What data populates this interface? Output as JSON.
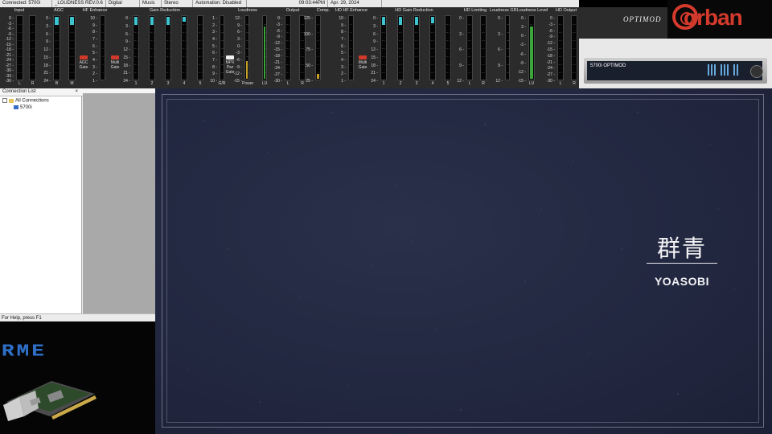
{
  "status_bar": {
    "connected": "Connected: 5700i",
    "preset": "_LOUDNESS REV.0.6",
    "input": "Digital",
    "mode": "Music",
    "stereo": "Stereo",
    "automation": "Automation: Disabled",
    "time": "09:03:44PM",
    "date": "Apr. 29, 2024"
  },
  "meters": {
    "brand_label": "OPTIMOD",
    "sections": [
      {
        "id": "input",
        "title": "Input",
        "ticks": [
          "0",
          "-3",
          "-6",
          "-9",
          "-12",
          "-15",
          "-18",
          "-21",
          "-24",
          "-27",
          "-30",
          "-33",
          "-36"
        ],
        "channels": [
          "L",
          "R"
        ],
        "levels": [
          0,
          0
        ]
      },
      {
        "id": "agc",
        "title": "AGC",
        "ticks": [
          "0",
          "3",
          "6",
          "9",
          "12",
          "15",
          "18",
          "21",
          "24"
        ],
        "channels": [
          "B",
          "M"
        ],
        "levels": [
          0.13,
          0.13
        ]
      },
      {
        "id": "hf_enhance",
        "title": "HF Enhance",
        "ticks": [
          "10",
          "9",
          "8",
          "7",
          "6",
          "5",
          "4",
          "3",
          "2",
          "1"
        ],
        "channels": [
          ""
        ],
        "levels": [
          0
        ]
      },
      {
        "id": "gain_reduction",
        "title": "Gain Reduction",
        "ticks": [
          "0",
          "3",
          "6",
          "9",
          "12",
          "15",
          "18",
          "21",
          "24"
        ],
        "channels": [
          "1",
          "2",
          "3",
          "4",
          "5"
        ],
        "levels": [
          0.13,
          0.13,
          0.13,
          0.08,
          0
        ]
      },
      {
        "id": "gr",
        "title": "",
        "ticks": [
          "1",
          "2",
          "3",
          "4",
          "5",
          "6",
          "7",
          "8",
          "9",
          "10"
        ],
        "channels": [
          "G/R"
        ],
        "levels": [
          0
        ]
      },
      {
        "id": "loudness",
        "title": "Loudness",
        "ticks": [
          "12",
          "9",
          "6",
          "3",
          "0",
          "-3",
          "-6",
          "-9",
          "-12",
          "-15"
        ],
        "channels": [
          "Power",
          "LU"
        ],
        "levels": [
          0.28,
          0.82
        ]
      },
      {
        "id": "output",
        "title": "Output",
        "ticks": [
          "0",
          "-3",
          "-6",
          "-9",
          "-12",
          "-15",
          "-18",
          "-21",
          "-24",
          "-27",
          "-30"
        ],
        "channels": [
          "L",
          "R"
        ],
        "levels": [
          0,
          0
        ]
      },
      {
        "id": "comp",
        "title": "Comp.",
        "ticks": [
          "125",
          "100",
          "75",
          "50",
          "25"
        ],
        "channels": [
          ""
        ],
        "levels": [
          0.08
        ]
      },
      {
        "id": "hd_hf_enhance",
        "title": "HD HF Enhance",
        "ticks": [
          "10",
          "9",
          "8",
          "7",
          "6",
          "5",
          "4",
          "3",
          "2",
          "1"
        ],
        "channels": [
          ""
        ],
        "levels": [
          0
        ]
      },
      {
        "id": "hd_gain_reduction",
        "title": "HD Gain Reduction",
        "ticks": [
          "0",
          "3",
          "6",
          "9",
          "12",
          "15",
          "18",
          "21",
          "24"
        ],
        "channels": [
          "1",
          "2",
          "3",
          "4",
          "5"
        ],
        "levels": [
          0.13,
          0.13,
          0.13,
          0.1,
          0
        ]
      },
      {
        "id": "hd_limiting",
        "title": "HD Limiting",
        "ticks": [
          "0",
          "3",
          "6",
          "9",
          "12"
        ],
        "channels": [
          "L",
          "R"
        ],
        "levels": [
          0,
          0
        ]
      },
      {
        "id": "loudness_gr",
        "title": "Loudness GR",
        "ticks": [
          "0",
          "3",
          "6",
          "9",
          "12"
        ],
        "channels": [
          ""
        ],
        "levels": [
          0
        ]
      },
      {
        "id": "loudness_level",
        "title": "Loudness Level",
        "ticks": [
          "6",
          "3",
          "0",
          "-3",
          "-6",
          "-9",
          "-12",
          "-15"
        ],
        "channels": [
          "LU"
        ],
        "levels": [
          0.82
        ]
      },
      {
        "id": "hd_output",
        "title": "HD Output",
        "ticks": [
          "0",
          "-3",
          "-6",
          "-9",
          "-12",
          "-15",
          "-18",
          "-21",
          "-24",
          "-27",
          "-30"
        ],
        "channels": [
          "L",
          "R"
        ],
        "levels": [
          0,
          0
        ]
      }
    ],
    "gates": {
      "agc_gate": "AGC Gate",
      "multi_gate": "Multi Gate",
      "mpx_gate": "MPX Pwr Gate",
      "hd_multi_gate": "Multi Gate"
    }
  },
  "orban": {
    "logo": "orban"
  },
  "device": {
    "model": "5700i",
    "face_text": "OPTIMOD"
  },
  "connection_list": {
    "title": "Connection List",
    "close": "×",
    "root": "All Connections",
    "child": "5700i",
    "status": "For Help, press F1"
  },
  "rme": {
    "logo": "RME"
  },
  "album": {
    "title": "群青",
    "artist": "YOASOBI"
  },
  "colors": {
    "meter_cyan": "#3bc4cf",
    "meter_green": "#3aa53a",
    "meter_yellow": "#c9a227",
    "gate_red": "#d13a2a",
    "orban_red": "#d33a2c",
    "rme_blue": "#2f6fc7",
    "album_bg": "#232843"
  }
}
